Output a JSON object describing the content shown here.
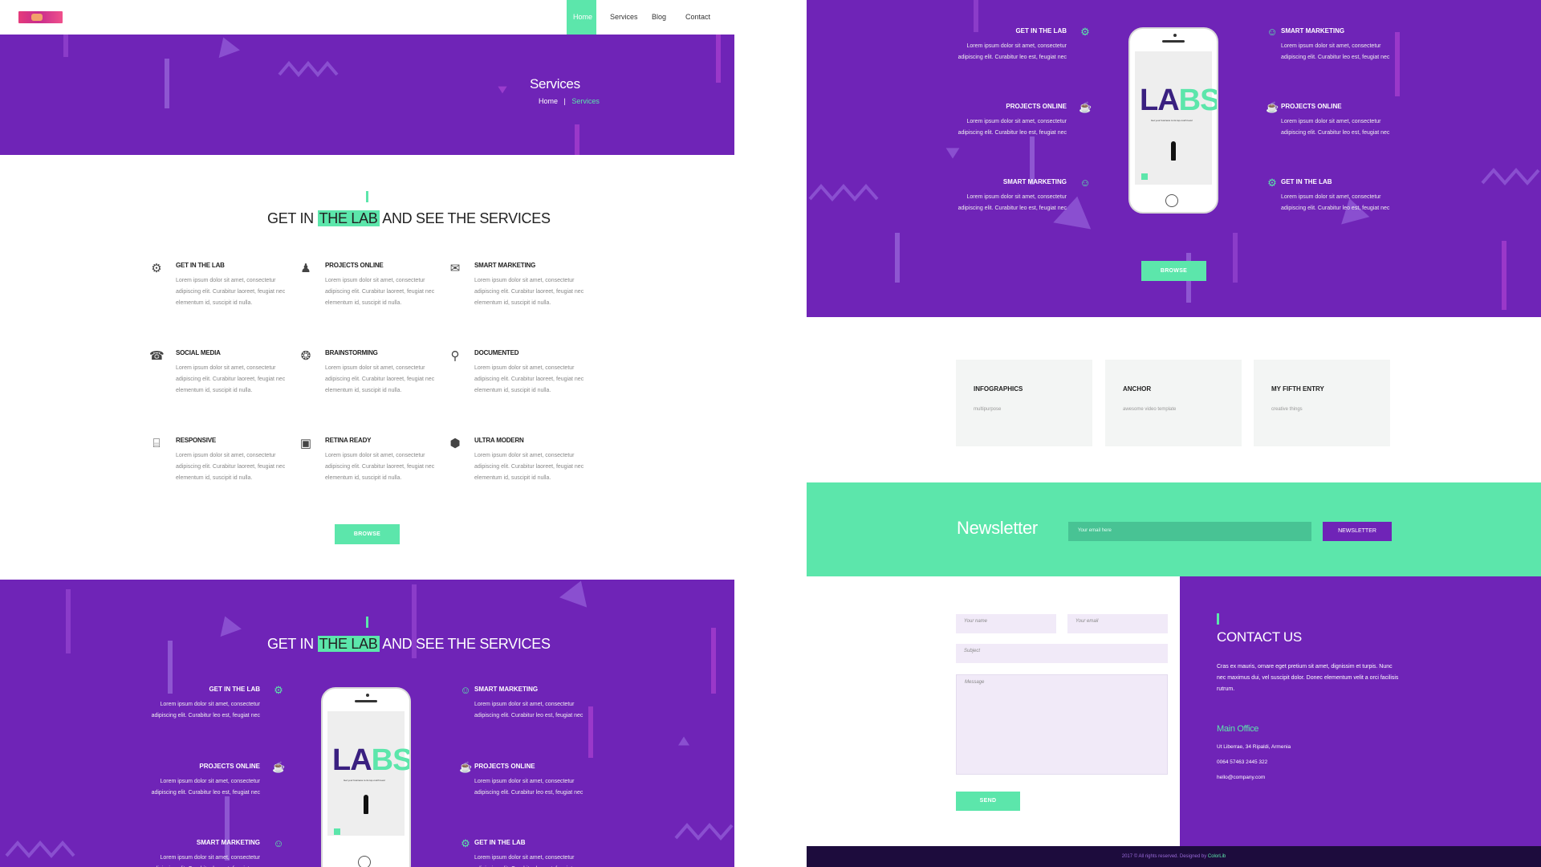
{
  "nav": {
    "items": [
      {
        "label": "Home",
        "active": true
      },
      {
        "label": "Services",
        "active": false
      },
      {
        "label": "Blog",
        "active": false
      },
      {
        "label": "Contact",
        "active": false
      }
    ]
  },
  "hero": {
    "title": "Services",
    "crumb_home": "Home",
    "crumb_sep": "|",
    "crumb_current": "Services"
  },
  "section1": {
    "title_pre": "GET IN",
    "title_hl": "THE LAB",
    "title_post": "AND SEE THE SERVICES",
    "services": [
      {
        "title": "GET IN THE LAB",
        "text": "Lorem ipsum dolor sit amet, consectetur adipiscing elit. Curabitur laoreet, feugiat nec elementum id, suscipit id nulla.",
        "icon": "robot-icon"
      },
      {
        "title": "PROJECTS ONLINE",
        "text": "Lorem ipsum dolor sit amet, consectetur adipiscing elit. Curabitur laoreet, feugiat nec elementum id, suscipit id nulla.",
        "icon": "chef-icon"
      },
      {
        "title": "SMART MARKETING",
        "text": "Lorem ipsum dolor sit amet, consectetur adipiscing elit. Curabitur laoreet, feugiat nec elementum id, suscipit id nulla.",
        "icon": "megaphone-icon"
      },
      {
        "title": "SOCIAL MEDIA",
        "text": "Lorem ipsum dolor sit amet, consectetur adipiscing elit. Curabitur laoreet, feugiat nec elementum id, suscipit id nulla.",
        "icon": "phone-icon"
      },
      {
        "title": "BRAINSTORMING",
        "text": "Lorem ipsum dolor sit amet, consectetur adipiscing elit. Curabitur laoreet, feugiat nec elementum id, suscipit id nulla.",
        "icon": "brain-icon"
      },
      {
        "title": "DOCUMENTED",
        "text": "Lorem ipsum dolor sit amet, consectetur adipiscing elit. Curabitur laoreet, feugiat nec elementum id, suscipit id nulla.",
        "icon": "magnifier-icon"
      },
      {
        "title": "RESPONSIVE",
        "text": "Lorem ipsum dolor sit amet, consectetur adipiscing elit. Curabitur laoreet, feugiat nec elementum id, suscipit id nulla.",
        "icon": "devices-icon"
      },
      {
        "title": "RETINA READY",
        "text": "Lorem ipsum dolor sit amet, consectetur adipiscing elit. Curabitur laoreet, feugiat nec elementum id, suscipit id nulla.",
        "icon": "image-icon"
      },
      {
        "title": "ULTRA MODERN",
        "text": "Lorem ipsum dolor sit amet, consectetur adipiscing elit. Curabitur laoreet, feugiat nec elementum id, suscipit id nulla.",
        "icon": "cube-icon"
      }
    ],
    "browse_label": "BROWSE"
  },
  "section2": {
    "title_pre": "GET IN",
    "title_hl": "THE LAB",
    "title_post": "AND SEE THE SERVICES",
    "left_features": [
      {
        "title": "GET IN THE LAB",
        "text": "Lorem ipsum dolor sit amet, consectetur adipiscing elit. Curabitur leo est, feugiat nec",
        "icon": "robot-icon"
      },
      {
        "title": "PROJECTS ONLINE",
        "text": "Lorem ipsum dolor sit amet, consectetur adipiscing elit. Curabitur leo est, feugiat nec",
        "icon": "cup-icon"
      },
      {
        "title": "SMART MARKETING",
        "text": "Lorem ipsum dolor sit amet, consectetur adipiscing elit. Curabitur leo est, feugiat nec",
        "icon": "person-icon"
      }
    ],
    "right_features": [
      {
        "title": "SMART MARKETING",
        "text": "Lorem ipsum dolor sit amet, consectetur adipiscing elit. Curabitur leo est, feugiat nec",
        "icon": "person-icon"
      },
      {
        "title": "PROJECTS ONLINE",
        "text": "Lorem ipsum dolor sit amet, consectetur adipiscing elit. Curabitur leo est, feugiat nec",
        "icon": "cup-icon"
      },
      {
        "title": "GET IN THE LAB",
        "text": "Lorem ipsum dolor sit amet, consectetur adipiscing elit. Curabitur leo est, feugiat nec",
        "icon": "robot-icon"
      }
    ],
    "phone": {
      "logo_a": "LA",
      "logo_b": "BS",
      "tagline": "Get your business to its top-notch level"
    },
    "browse_label": "BROWSE"
  },
  "cards": [
    {
      "title": "INFOGRAPHICS",
      "subtitle": "multipurpose"
    },
    {
      "title": "ANCHOR",
      "subtitle": "awesome video template"
    },
    {
      "title": "MY FIFTH ENTRY",
      "subtitle": "creative things"
    }
  ],
  "newsletter": {
    "title": "Newsletter",
    "placeholder": "Your email here",
    "button": "NEWSLETTER"
  },
  "contact": {
    "name_placeholder": "Your name",
    "email_placeholder": "Your email",
    "subject_placeholder": "Subject",
    "message_placeholder": "Message",
    "send_label": "SEND",
    "heading": "CONTACT US",
    "paragraph": "Cras ex mauris, ornare eget pretium sit amet, dignissim et turpis. Nunc nec maximus dui, vel suscipit dolor. Donec elementum velit a orci facilisis rutrum.",
    "office_title": "Main Office",
    "address": "Ut Liberrae, 34 Ripaldi, Armenia",
    "phone": "0064 57463 2445 322",
    "email": "hello@company.com"
  },
  "footer": {
    "text": "2017 © All rights reserved. Designed by",
    "brand": "ColorLib"
  },
  "colors": {
    "purple": "#6f24b7",
    "green": "#5ce6ab",
    "dark": "#1d0c3d"
  }
}
